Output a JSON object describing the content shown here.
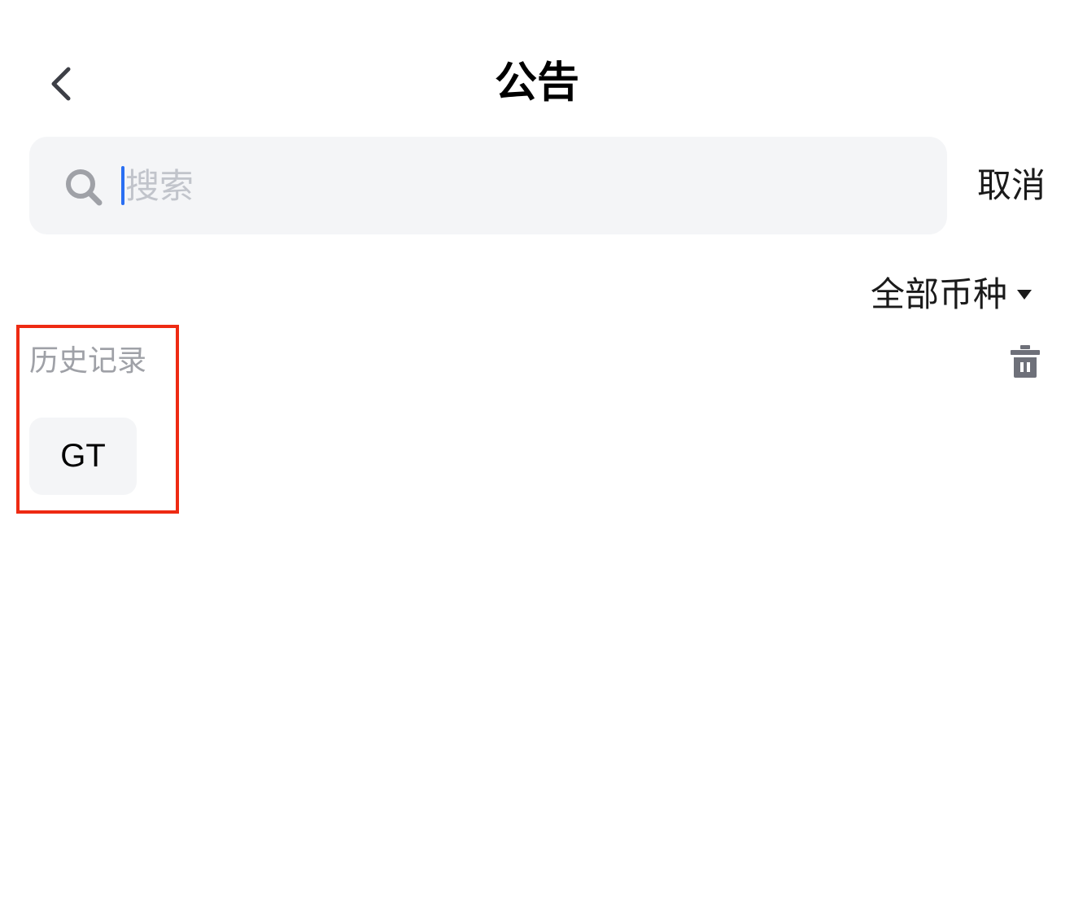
{
  "header": {
    "title": "公告",
    "back_icon": "chevron-left-icon"
  },
  "search": {
    "placeholder": "搜索",
    "value": "",
    "icon": "search-icon",
    "cancel_label": "取消"
  },
  "filter": {
    "currency_label": "全部币种",
    "icon": "caret-down-icon"
  },
  "history": {
    "title": "历史记录",
    "clear_icon": "trash-icon",
    "items": [
      "GT"
    ]
  },
  "colors": {
    "background": "#ffffff",
    "search_bg": "#f4f5f7",
    "placeholder": "#c1c4cb",
    "caret": "#2a6ff2",
    "muted_text": "#9fa1a7",
    "icon_gray": "#6e7079",
    "highlight_border": "#ee2a12"
  }
}
